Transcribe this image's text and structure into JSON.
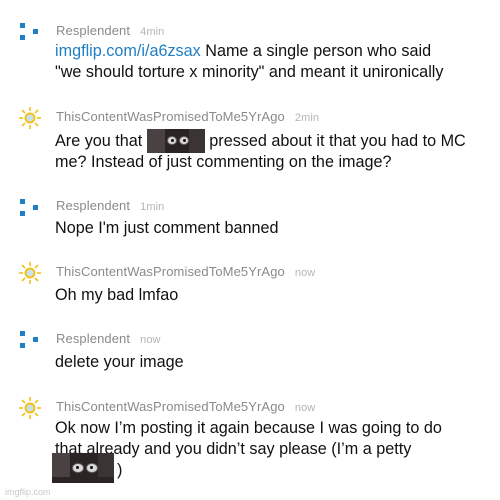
{
  "comments": [
    {
      "username": "Resplendent",
      "time": "4min",
      "avatar_icon": "blue-pixel-avatar-icon",
      "link": "imgflip.com/i/a6zsax",
      "text_1": " Name a single person who said",
      "text_2": "\"we should torture x minority\" and meant it unironically"
    },
    {
      "username": "ThisContentWasPromisedToMe5YrAgo",
      "time": "2min",
      "avatar_icon": "sun-avatar-icon",
      "text_before_image": "Are you that ",
      "text_after_image": " pressed about it that you had to MC",
      "text_2": "me? Instead of just commenting on the image?"
    },
    {
      "username": "Resplendent",
      "time": "1min",
      "avatar_icon": "blue-pixel-avatar-icon",
      "text": "Nope I'm just comment banned"
    },
    {
      "username": "ThisContentWasPromisedToMe5YrAgo",
      "time": "now",
      "avatar_icon": "sun-avatar-icon",
      "text": "Oh my bad lmfao"
    },
    {
      "username": "Resplendent",
      "time": "now",
      "avatar_icon": "blue-pixel-avatar-icon",
      "text": "delete your image"
    },
    {
      "username": "ThisContentWasPromisedToMe5YrAgo",
      "time": "now",
      "avatar_icon": "sun-avatar-icon",
      "text_1": "Ok now I’m posting it again because I was going to do",
      "text_2": "that already and you didn’t say please (I’m a petty",
      "text_3_tail": ")"
    }
  ],
  "colors": {
    "username": "#8a8a8a",
    "timestamp": "#b5b5b5",
    "link": "#1f7fc4",
    "body_text": "#111111",
    "pixel_avatar": "#1f7fc4",
    "sun_avatar": "#f2c21b"
  },
  "watermark": "imgflip.com"
}
